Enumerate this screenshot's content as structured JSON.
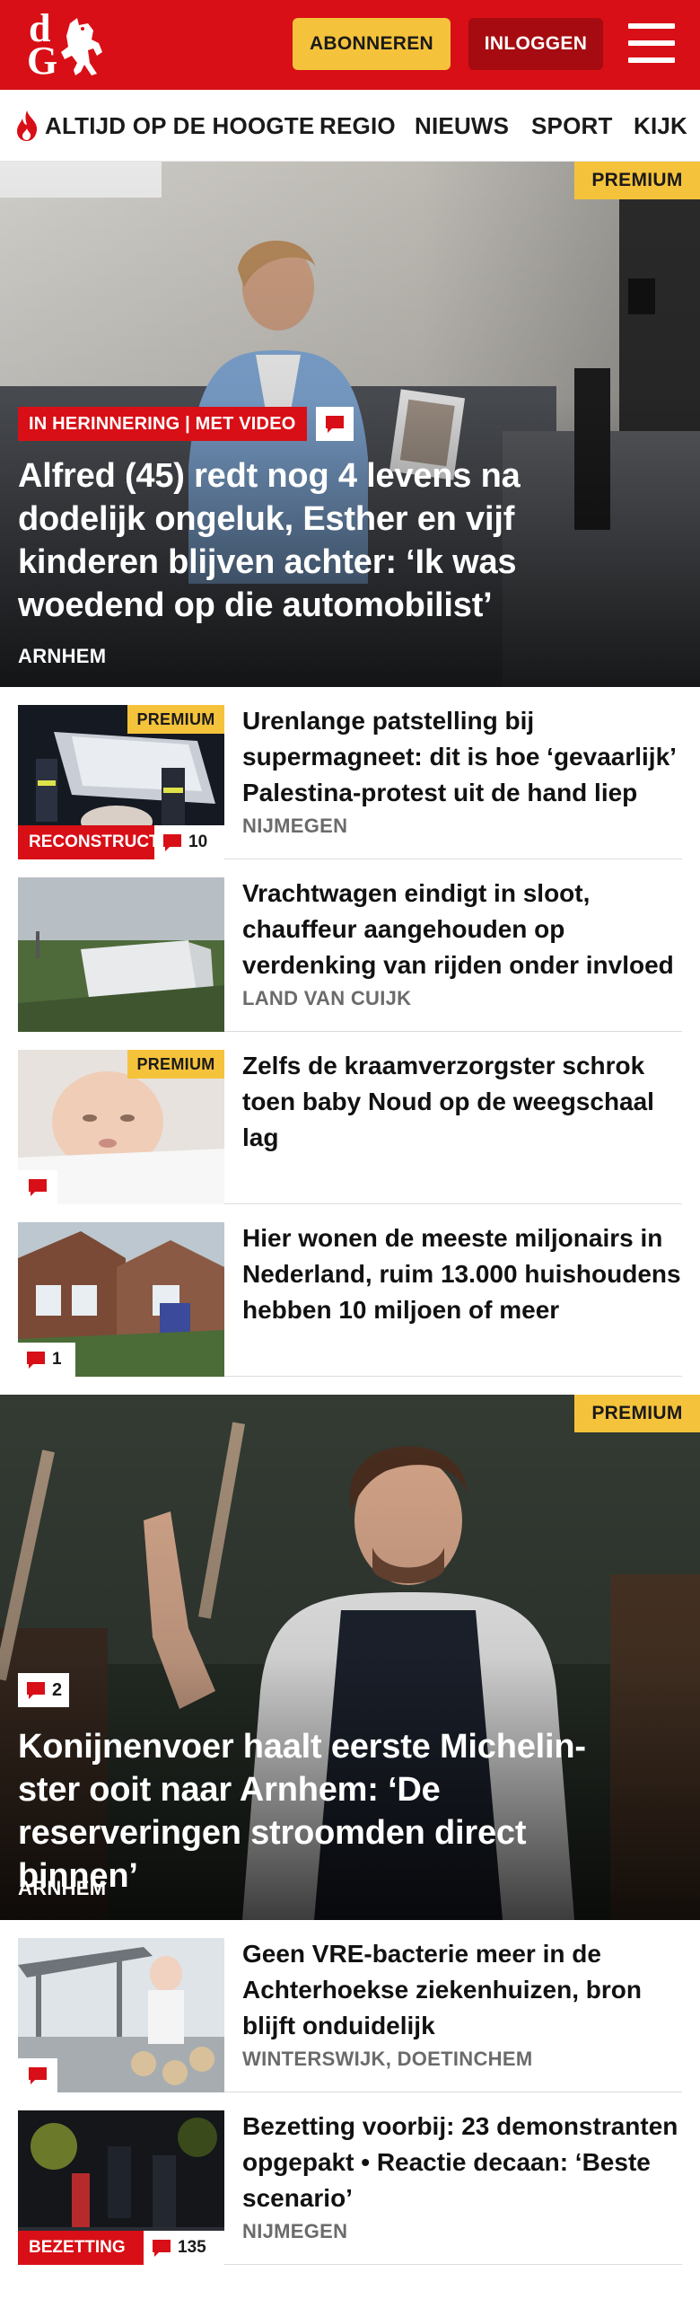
{
  "header": {
    "logo_letters": [
      "d",
      "G"
    ],
    "subscribe_label": "ABONNEREN",
    "login_label": "INLOGGEN"
  },
  "nav": {
    "items": [
      "ALTIJD OP DE HOOGTE",
      "REGIO",
      "NIEUWS",
      "SPORT",
      "KIJK"
    ]
  },
  "colors": {
    "brand_red": "#d80f16",
    "premium_yellow": "#f5c33b",
    "login_dark_red": "#a50b10"
  },
  "hero1": {
    "premium": "PREMIUM",
    "label": "IN HERINNERING | MET VIDEO",
    "title": "Alfred (45) redt nog 4 levens na dodelijk ongeluk, Esther en vijf kinderen blijven achter: ‘Ik was woedend op die automobilist’",
    "location": "ARNHEM"
  },
  "list1": [
    {
      "premium": "PREMIUM",
      "label": "RECONSTRUCTIE",
      "comments": "10",
      "title": "Urenlange patstelling bij supermagneet: dit is hoe ‘gevaarlijk’ Palestina-protest uit de hand liep",
      "location": "NIJMEGEN"
    },
    {
      "title": "Vrachtwagen eindigt in sloot, chauffeur aangehouden op verdenking van rijden onder invloed",
      "location": "LAND VAN CUIJK"
    },
    {
      "premium": "PREMIUM",
      "comments": "",
      "title": "Zelfs de kraamverzorgster schrok toen baby Noud op de weegschaal lag",
      "location": ""
    },
    {
      "comments": "1",
      "title": "Hier wonen de meeste miljonairs in Nederland, ruim 13.000 huishoudens hebben 10 miljoen of meer",
      "location": ""
    }
  ],
  "hero2": {
    "premium": "PREMIUM",
    "comments": "2",
    "title": "Konijnenvoer haalt eerste Michelin-ster ooit naar Arnhem: ‘De reserveringen stroomden direct binnen’",
    "location": "ARNHEM"
  },
  "list2": [
    {
      "comments": "",
      "title": "Geen VRE-bacterie meer in de Achterhoekse ziekenhuizen, bron blijft onduidelijk",
      "location": "WINTERSWIJK, DOETINCHEM"
    },
    {
      "label": "BEZETTING",
      "comments": "135",
      "title": "Bezetting voorbij: 23 demonstranten opgepakt • Reactie decaan: ‘Beste scenario’",
      "location": "NIJMEGEN"
    }
  ]
}
